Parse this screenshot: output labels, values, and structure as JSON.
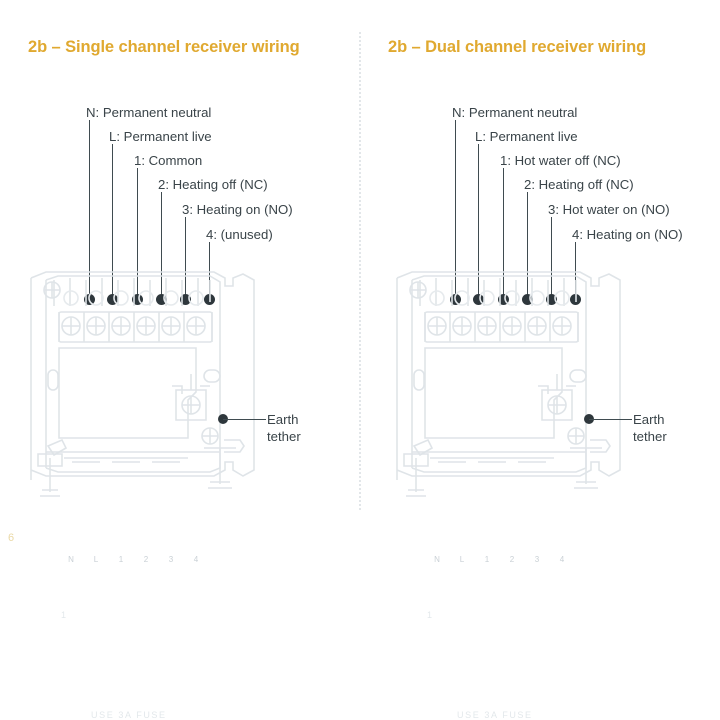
{
  "document": {
    "page_number": "6"
  },
  "panels": [
    {
      "id": "single-channel",
      "title": "2b – Single channel receiver wiring",
      "title_color": "#e0a930",
      "terminal_labels": [
        "N",
        "L",
        "1",
        "2",
        "3",
        "4"
      ],
      "callouts": [
        {
          "terminal": "N",
          "text": "N: Permanent neutral"
        },
        {
          "terminal": "L",
          "text": "L: Permanent live"
        },
        {
          "terminal": "1",
          "text": "1: Common"
        },
        {
          "terminal": "2",
          "text": "2: Heating off (NC)"
        },
        {
          "terminal": "3",
          "text": "3: Heating on (NO)"
        },
        {
          "terminal": "4",
          "text": "4: (unused)"
        }
      ],
      "earth_tether": {
        "line1": "Earth",
        "line2": "tether"
      },
      "device_text": {
        "fuse_note": "USE 3A FUSE",
        "mark": "1"
      }
    },
    {
      "id": "dual-channel",
      "title": "2b – Dual channel receiver wiring",
      "title_color": "#e0a930",
      "terminal_labels": [
        "N",
        "L",
        "1",
        "2",
        "3",
        "4"
      ],
      "callouts": [
        {
          "terminal": "N",
          "text": "N: Permanent neutral"
        },
        {
          "terminal": "L",
          "text": "L: Permanent live"
        },
        {
          "terminal": "1",
          "text": "1: Hot water off (NC)"
        },
        {
          "terminal": "2",
          "text": "2: Heating off (NC)"
        },
        {
          "terminal": "3",
          "text": "3: Hot water on (NO)"
        },
        {
          "terminal": "4",
          "text": "4: Heating on (NO)"
        }
      ],
      "earth_tether": {
        "line1": "Earth",
        "line2": "tether"
      },
      "device_text": {
        "fuse_note": "USE 3A FUSE",
        "mark": "1"
      }
    }
  ],
  "colors": {
    "text": "#3a4449",
    "accent": "#e0a930",
    "device_outline": "#dfe4e8",
    "dot": "#2e373c",
    "divider": "#e2e6e9",
    "page_number": "#ead9a6"
  }
}
